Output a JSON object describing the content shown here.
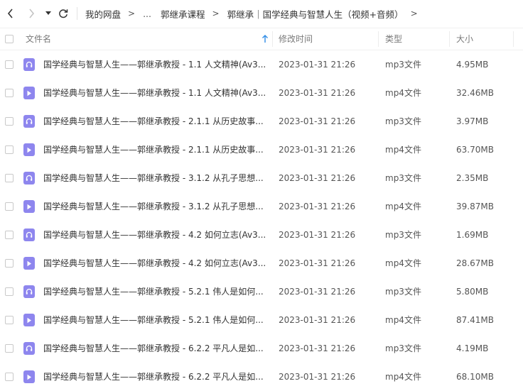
{
  "breadcrumb": {
    "root": "我的网盘",
    "ellipsis": "...",
    "folder": "郭继承课程",
    "current": "郭继承｜国学经典与智慧人生（视频+音频）",
    "sep": ">"
  },
  "columns": {
    "name": "文件名",
    "modified": "修改时间",
    "type": "类型",
    "size": "大小"
  },
  "icons": {
    "audio": "headphones-icon",
    "video": "play-icon",
    "accent": "#8e86ee",
    "sort_arrow_color": "#2e8ce6"
  },
  "files": [
    {
      "name": "国学经典与智慧人生——郭继承教授 - 1.1 人文精神(Av3...",
      "date": "2023-01-31 21:26",
      "type": "mp3文件",
      "size": "4.95MB",
      "kind": "audio"
    },
    {
      "name": "国学经典与智慧人生——郭继承教授 - 1.1 人文精神(Av3...",
      "date": "2023-01-31 21:26",
      "type": "mp4文件",
      "size": "32.46MB",
      "kind": "video"
    },
    {
      "name": "国学经典与智慧人生——郭继承教授 - 2.1.1 从历史故事...",
      "date": "2023-01-31 21:26",
      "type": "mp3文件",
      "size": "3.97MB",
      "kind": "audio"
    },
    {
      "name": "国学经典与智慧人生——郭继承教授 - 2.1.1 从历史故事...",
      "date": "2023-01-31 21:26",
      "type": "mp4文件",
      "size": "63.70MB",
      "kind": "video"
    },
    {
      "name": "国学经典与智慧人生——郭继承教授 - 3.1.2 从孔子思想...",
      "date": "2023-01-31 21:26",
      "type": "mp3文件",
      "size": "2.35MB",
      "kind": "audio"
    },
    {
      "name": "国学经典与智慧人生——郭继承教授 - 3.1.2 从孔子思想...",
      "date": "2023-01-31 21:26",
      "type": "mp4文件",
      "size": "39.87MB",
      "kind": "video"
    },
    {
      "name": "国学经典与智慧人生——郭继承教授 - 4.2 如何立志(Av3...",
      "date": "2023-01-31 21:26",
      "type": "mp3文件",
      "size": "1.69MB",
      "kind": "audio"
    },
    {
      "name": "国学经典与智慧人生——郭继承教授 - 4.2 如何立志(Av3...",
      "date": "2023-01-31 21:26",
      "type": "mp4文件",
      "size": "28.67MB",
      "kind": "video"
    },
    {
      "name": "国学经典与智慧人生——郭继承教授 - 5.2.1 伟人是如何...",
      "date": "2023-01-31 21:26",
      "type": "mp3文件",
      "size": "5.80MB",
      "kind": "audio"
    },
    {
      "name": "国学经典与智慧人生——郭继承教授 - 5.2.1 伟人是如何...",
      "date": "2023-01-31 21:26",
      "type": "mp4文件",
      "size": "87.41MB",
      "kind": "video"
    },
    {
      "name": "国学经典与智慧人生——郭继承教授 - 6.2.2 平凡人是如...",
      "date": "2023-01-31 21:26",
      "type": "mp3文件",
      "size": "4.19MB",
      "kind": "audio"
    },
    {
      "name": "国学经典与智慧人生——郭继承教授 - 6.2.2 平凡人是如...",
      "date": "2023-01-31 21:26",
      "type": "mp4文件",
      "size": "68.10MB",
      "kind": "video"
    }
  ]
}
